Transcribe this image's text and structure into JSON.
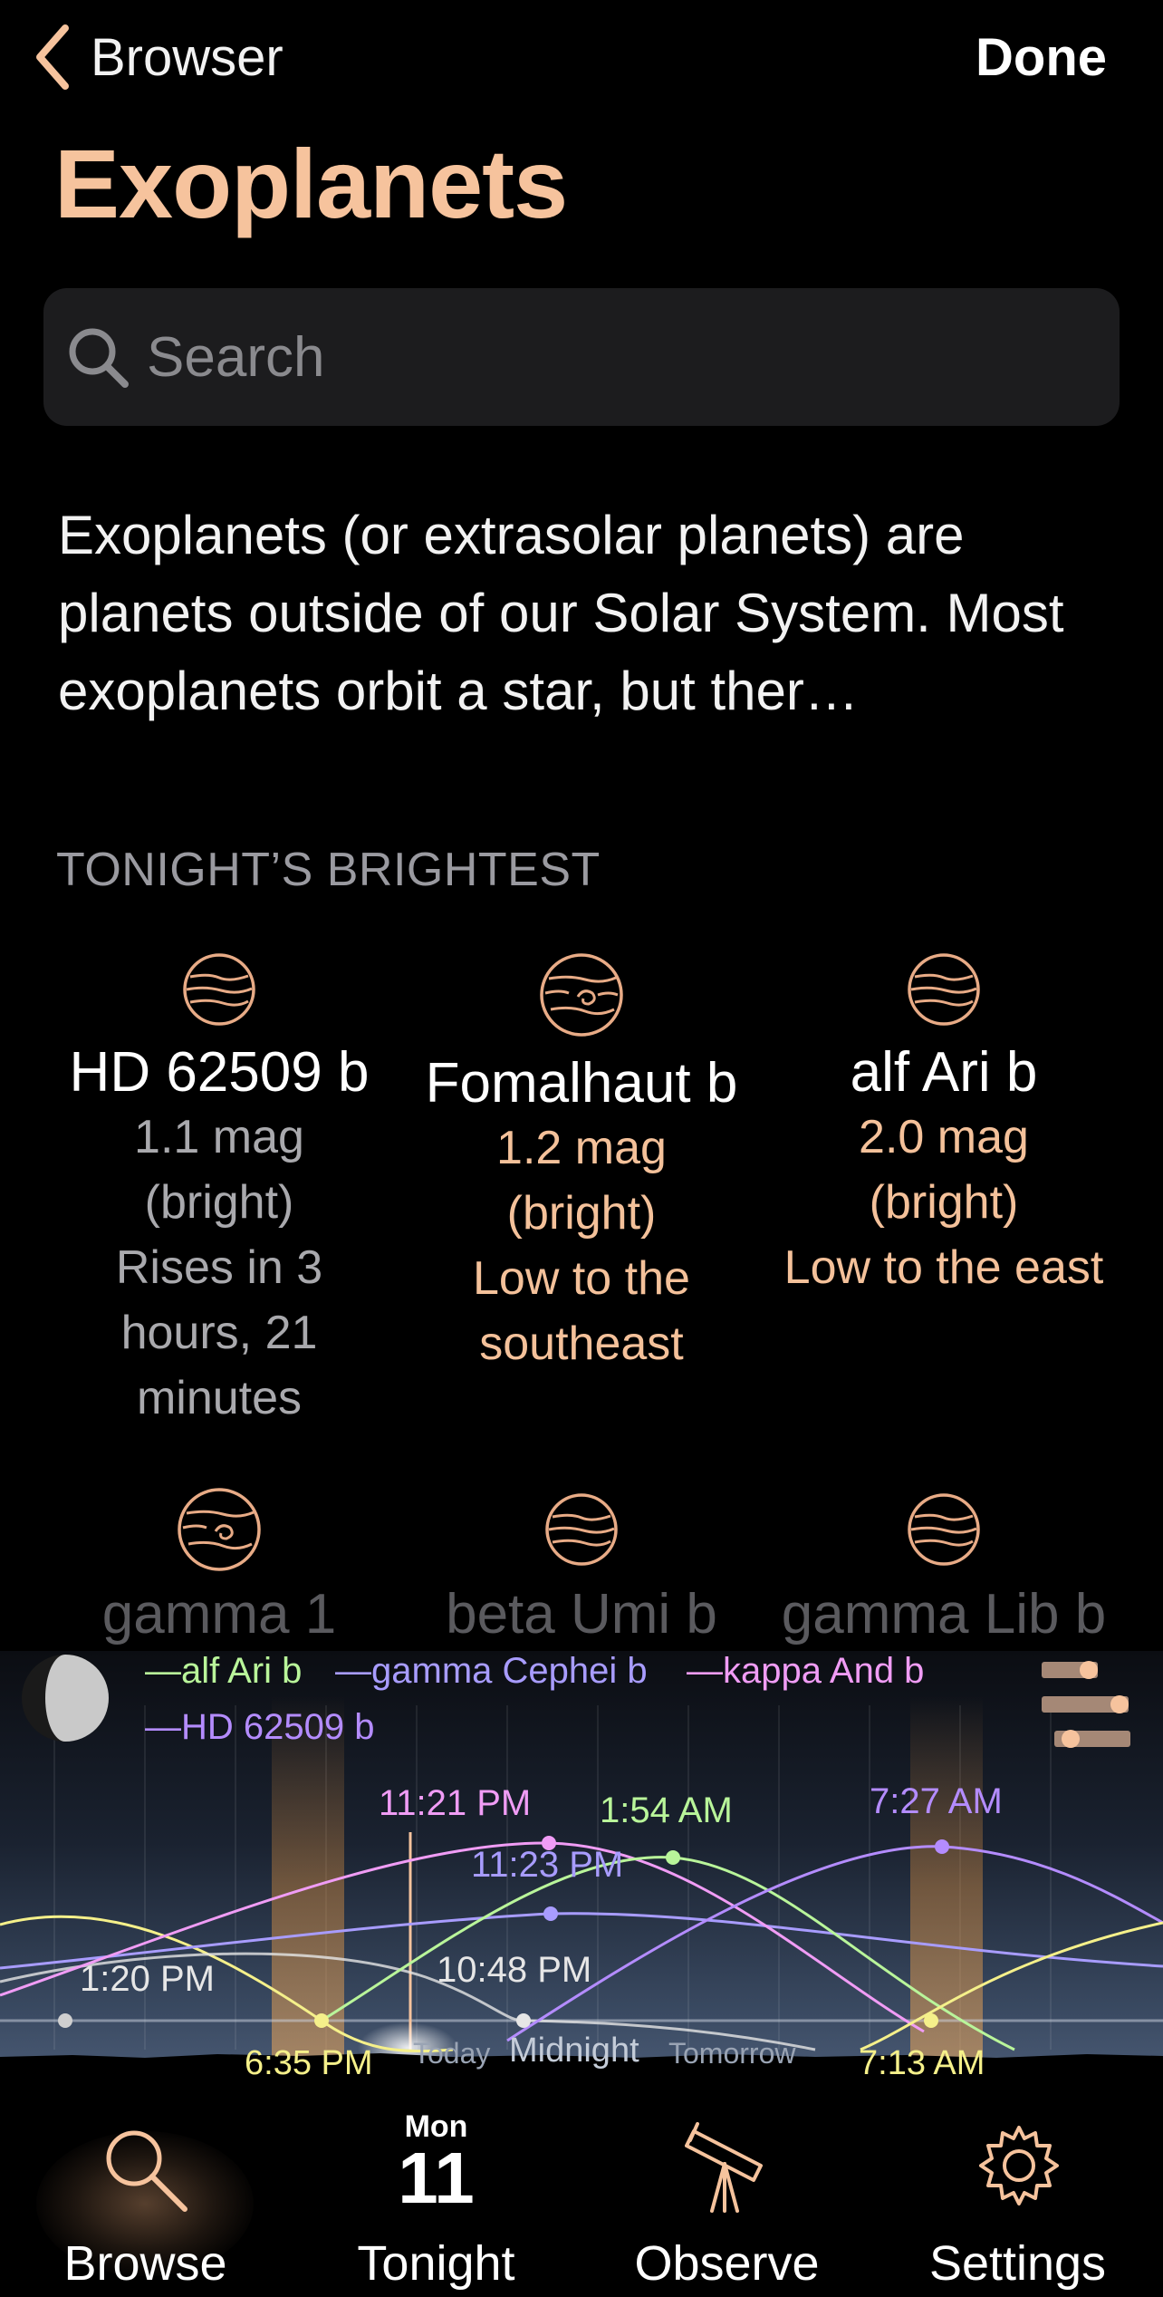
{
  "nav": {
    "back_label": "Browser",
    "done_label": "Done"
  },
  "title": "Exoplanets",
  "search": {
    "placeholder": "Search",
    "value": ""
  },
  "description": "Exoplanets (or extrasolar planets) are planets outside of our Solar System. Most exoplanets orbit a star, but ther…",
  "section_header": "TONIGHT’S BRIGHTEST",
  "colors": {
    "accent": "#f6c39d",
    "peach_text": "#f4c19a",
    "gray_text": "#a9a9ad"
  },
  "brightest": [
    {
      "name": "HD 62509 b",
      "mag": "1.1 mag",
      "brightness": "(bright)",
      "status": "Rises in 3 hours, 21 minutes",
      "tone": "gray",
      "icon": "banded-planet-icon"
    },
    {
      "name": "Fomalhaut b",
      "mag": "1.2 mag",
      "brightness": "(bright)",
      "status": "Low to the southeast",
      "tone": "peach",
      "icon": "swirl-planet-icon"
    },
    {
      "name": "alf Ari b",
      "mag": "2.0 mag",
      "brightness": "(bright)",
      "status": "Low to the east",
      "tone": "peach",
      "icon": "banded-planet-icon"
    }
  ],
  "more": [
    {
      "name": "gamma 1",
      "icon": "swirl-planet-icon"
    },
    {
      "name": "beta Umi b",
      "icon": "banded-planet-icon"
    },
    {
      "name": "gamma Lib b",
      "icon": "banded-planet-icon"
    }
  ],
  "chart_data": {
    "type": "line",
    "title": "",
    "legend": [
      "alf Ari b",
      "gamma Cephei b",
      "kappa And b",
      "HD 62509 b"
    ],
    "series_colors": {
      "alf Ari b": "#b9f59a",
      "gamma Cephei b": "#a89cff",
      "kappa And b": "#f09cf5",
      "HD 62509 b": "#b48cff"
    },
    "x_labels": [
      "Today",
      "Midnight",
      "Tomorrow"
    ],
    "annotations": [
      {
        "label": "11:21 PM",
        "color": "#f09cf5"
      },
      {
        "label": "1:54 AM",
        "color": "#b9f59a"
      },
      {
        "label": "7:27 AM",
        "color": "#b48cff"
      },
      {
        "label": "11:23 PM",
        "color": "#a89cff"
      },
      {
        "label": "10:48 PM",
        "color": "#e6e6e6"
      },
      {
        "label": "1:20 PM",
        "color": "#e6e6e6"
      },
      {
        "label": "6:35 PM",
        "color": "#f5f08a"
      },
      {
        "label": "7:13 AM",
        "color": "#f5f08a"
      }
    ],
    "moon_phase_icon": "moon-icon",
    "filter_icon": "sliders-icon"
  },
  "tabs": [
    {
      "label": "Browse",
      "icon": "search-icon",
      "selected": true
    },
    {
      "label": "Tonight",
      "day_name": "Mon",
      "day_number": "11"
    },
    {
      "label": "Observe",
      "icon": "telescope-icon"
    },
    {
      "label": "Settings",
      "icon": "gear-icon"
    }
  ]
}
